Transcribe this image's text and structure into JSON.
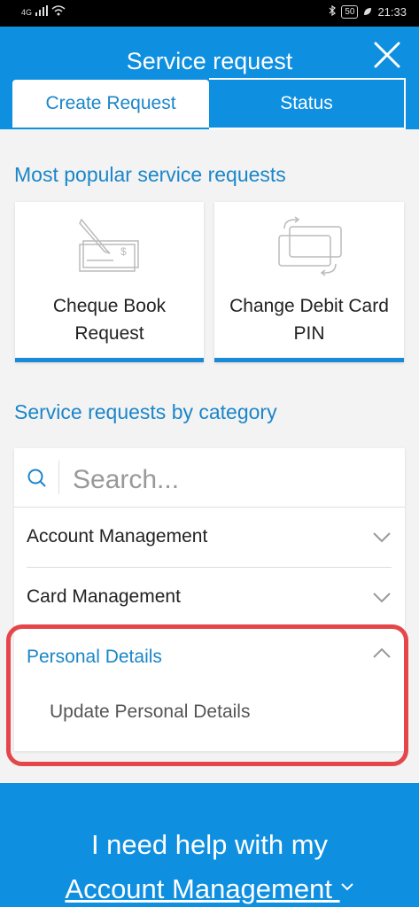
{
  "status_bar": {
    "network": "4G",
    "battery": "50",
    "time": "21:33"
  },
  "header": {
    "title": "Service request",
    "tabs": [
      {
        "label": "Create Request",
        "active": true
      },
      {
        "label": "Status",
        "active": false
      }
    ]
  },
  "popular": {
    "heading": "Most popular service requests",
    "cards": [
      {
        "label_line1": "Cheque Book",
        "label_line2": "Request",
        "icon": "cheque-book-icon"
      },
      {
        "label_line1": "Change Debit Card",
        "label_line2": "PIN",
        "icon": "card-swap-icon"
      }
    ]
  },
  "categories": {
    "heading": "Service requests by category",
    "search_placeholder": "Search...",
    "items": [
      {
        "label": "Account Management",
        "expanded": false
      },
      {
        "label": "Card Management",
        "expanded": false
      },
      {
        "label": "Personal Details",
        "expanded": true,
        "sub_items": [
          "Update Personal Details"
        ]
      }
    ]
  },
  "footer": {
    "line1": "I need help with my",
    "line2": "Account Management"
  },
  "colors": {
    "primary": "#0e8fe0",
    "accent_text": "#1b86c9",
    "highlight": "#e5464a"
  }
}
